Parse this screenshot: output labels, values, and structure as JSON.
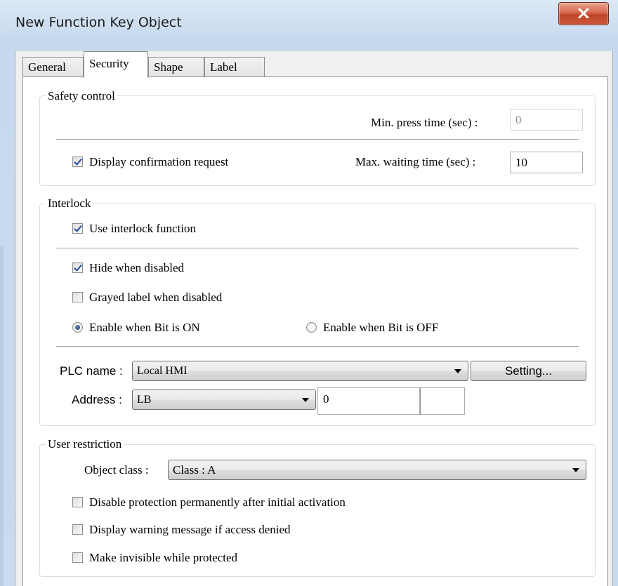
{
  "window": {
    "title": "New Function Key Object"
  },
  "tabs": [
    {
      "label": "General"
    },
    {
      "label": "Security"
    },
    {
      "label": "Shape"
    },
    {
      "label": "Label"
    }
  ],
  "active_tab": "Security",
  "safety_control": {
    "title": "Safety control",
    "min_press_label": "Min. press time (sec) :",
    "min_press_value": "0",
    "display_confirmation": {
      "label": "Display confirmation request",
      "checked": true
    },
    "max_wait_label": "Max. waiting time (sec) :",
    "max_wait_value": "10"
  },
  "interlock": {
    "title": "Interlock",
    "use_interlock": {
      "label": "Use interlock function",
      "checked": true
    },
    "hide_when_disabled": {
      "label": "Hide when disabled",
      "checked": true
    },
    "grayed_label": {
      "label": "Grayed label when disabled",
      "checked": false
    },
    "enable_on": {
      "label": "Enable when Bit is ON",
      "selected": true
    },
    "enable_off": {
      "label": "Enable when Bit is OFF",
      "selected": false
    },
    "plc_name_label": "PLC name :",
    "plc_name_value": "Local HMI",
    "setting_button": "Setting...",
    "address_label": "Address :",
    "address_device": "LB",
    "address_value": "0",
    "address_extra": ""
  },
  "user_restriction": {
    "title": "User restriction",
    "object_class_label": "Object class :",
    "object_class_value": "Class : A",
    "disable_protection": {
      "label": "Disable protection permanently after initial activation",
      "checked": false
    },
    "display_warning": {
      "label": "Display warning message if access denied",
      "checked": false
    },
    "make_invisible": {
      "label": "Make invisible while protected",
      "checked": false
    }
  },
  "colors": {
    "title_bar": "#c9dbee",
    "close_button": "#c9573c",
    "checkbox_mark": "#1f4f9c"
  }
}
